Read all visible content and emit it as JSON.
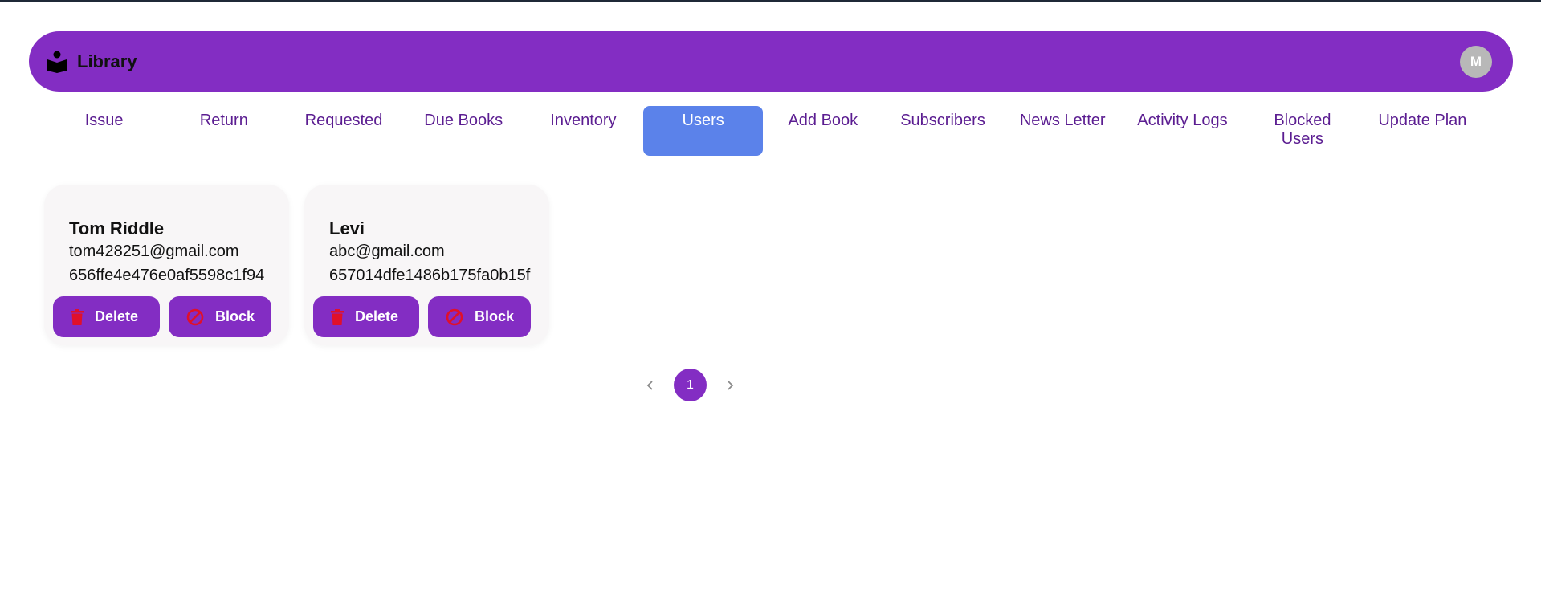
{
  "navbar": {
    "brand_icon": "book-reader-icon",
    "title": "Library",
    "avatar_initial": "M",
    "color": "#832dc3"
  },
  "tabs": [
    {
      "label": "Issue"
    },
    {
      "label": "Return"
    },
    {
      "label": "Requested"
    },
    {
      "label": "Due Books"
    },
    {
      "label": "Inventory"
    },
    {
      "label": "Users",
      "active": true
    },
    {
      "label": "Add Book"
    },
    {
      "label": "Subscribers"
    },
    {
      "label": "News Letter"
    },
    {
      "label": "Activity Logs"
    },
    {
      "label": "Blocked Users"
    },
    {
      "label": "Update Plan"
    }
  ],
  "users": [
    {
      "name": "Tom Riddle",
      "email": "tom428251@gmail.com",
      "id": "656ffe4e476e0af5598c1f94",
      "delete_label": "Delete",
      "block_label": "Block"
    },
    {
      "name": "Levi",
      "email": "abc@gmail.com",
      "id": "657014dfe1486b175fa0b15f",
      "delete_label": "Delete",
      "block_label": "Block"
    }
  ],
  "pagination": {
    "current_page": "1"
  },
  "icons": {
    "delete": "trash-icon",
    "block": "ban-icon",
    "prev": "chevron-left-icon",
    "next": "chevron-right-icon"
  },
  "colors": {
    "accent": "#832dc3",
    "active_tab": "#5b82ea",
    "tab_text": "#5b1d91",
    "icon_red": "#e0102a"
  }
}
